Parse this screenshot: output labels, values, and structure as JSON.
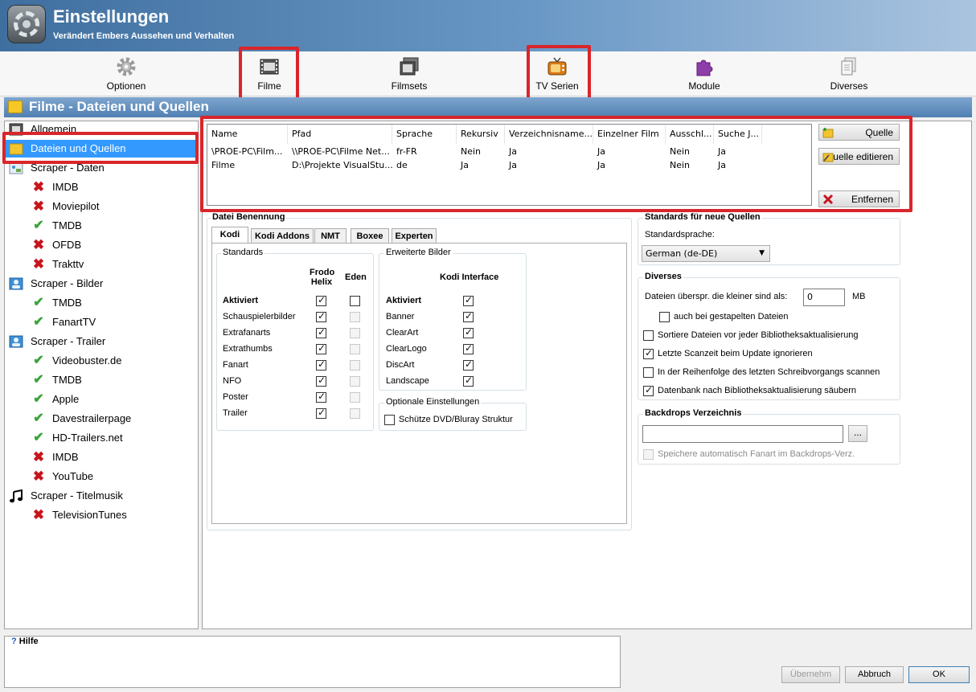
{
  "header": {
    "title": "Einstellungen",
    "subtitle": "Verändert Embers Aussehen und Verhalten"
  },
  "toolbar": {
    "items": [
      {
        "label": "Optionen",
        "icon": "gear-icon"
      },
      {
        "label": "Filme",
        "icon": "film-icon"
      },
      {
        "label": "Filmsets",
        "icon": "filmsets-icon"
      },
      {
        "label": "TV Serien",
        "icon": "tv-icon"
      },
      {
        "label": "Module",
        "icon": "puzzle-icon"
      },
      {
        "label": "Diverses",
        "icon": "documents-icon"
      }
    ]
  },
  "section": {
    "title": "Filme - Dateien und Quellen"
  },
  "tree": {
    "items": [
      {
        "label": "Allgemein",
        "icon": "film-icon"
      },
      {
        "label": "Dateien und Quellen",
        "icon": "folder-icon",
        "selected": true
      },
      {
        "label": "Scraper - Daten",
        "icon": "scraper-icon"
      },
      {
        "label": "IMDB",
        "status": "disabled"
      },
      {
        "label": "Moviepilot",
        "status": "disabled"
      },
      {
        "label": "TMDB",
        "status": "enabled"
      },
      {
        "label": "OFDB",
        "status": "disabled"
      },
      {
        "label": "Trakttv",
        "status": "disabled"
      },
      {
        "label": "Scraper - Bilder",
        "icon": "image-icon"
      },
      {
        "label": "TMDB",
        "status": "enabled"
      },
      {
        "label": "FanartTV",
        "status": "enabled"
      },
      {
        "label": "Scraper - Trailer",
        "icon": "image-icon"
      },
      {
        "label": "Videobuster.de",
        "status": "enabled"
      },
      {
        "label": "TMDB",
        "status": "enabled"
      },
      {
        "label": "Apple",
        "status": "enabled"
      },
      {
        "label": "Davestrailerpage",
        "status": "enabled"
      },
      {
        "label": "HD-Trailers.net",
        "status": "enabled"
      },
      {
        "label": "IMDB",
        "status": "disabled"
      },
      {
        "label": "YouTube",
        "status": "disabled"
      },
      {
        "label": "Scraper - Titelmusik",
        "icon": "music-icon"
      },
      {
        "label": "TelevisionTunes",
        "status": "disabled"
      }
    ]
  },
  "sources": {
    "columns": [
      "Name",
      "Pfad",
      "Sprache",
      "Rekursiv",
      "Verzeichnisname...",
      "Einzelner Film",
      "Ausschl...",
      "Suche J..."
    ],
    "rows": [
      [
        "\\PROE-PC\\Film...",
        "\\\\PROE-PC\\Filme Net...",
        "fr-FR",
        "Nein",
        "Ja",
        "Ja",
        "Nein",
        "Ja"
      ],
      [
        "Filme",
        "D:\\Projekte VisualStu...",
        "de",
        "Ja",
        "Ja",
        "Ja",
        "Nein",
        "Ja"
      ]
    ],
    "btn_add": "Quelle",
    "btn_edit": "Quelle editieren",
    "btn_remove": "Entfernen"
  },
  "naming": {
    "title": "Datei Benennung",
    "tabs": [
      "Kodi",
      "Kodi Addons",
      "NMT",
      "Boxee",
      "Experten"
    ],
    "standards": {
      "title": "Standards",
      "col1": "Frodo\nHelix",
      "col2": "Eden",
      "rows": [
        {
          "label": "Aktiviert",
          "bold": true,
          "frodo": true,
          "eden": false,
          "eden_enabled": true
        },
        {
          "label": "Schauspielerbilder",
          "frodo": true,
          "eden": false
        },
        {
          "label": "Extrafanarts",
          "frodo": true,
          "eden": false
        },
        {
          "label": "Extrathumbs",
          "frodo": true,
          "eden": false
        },
        {
          "label": "Fanart",
          "frodo": true,
          "eden": false
        },
        {
          "label": "NFO",
          "frodo": true,
          "eden": false
        },
        {
          "label": "Poster",
          "frodo": true,
          "eden": false
        },
        {
          "label": "Trailer",
          "frodo": true,
          "eden": false
        }
      ]
    },
    "extended": {
      "title": "Erweiterte Bilder",
      "col": "Kodi Interface",
      "rows": [
        {
          "label": "Aktiviert",
          "bold": true,
          "checked": true
        },
        {
          "label": "Banner",
          "checked": true
        },
        {
          "label": "ClearArt",
          "checked": true
        },
        {
          "label": "ClearLogo",
          "checked": true
        },
        {
          "label": "DiscArt",
          "checked": true
        },
        {
          "label": "Landscape",
          "checked": true
        }
      ]
    },
    "optional": {
      "title": "Optionale Einstellungen",
      "protect_label": "Schütze DVD/Bluray Struktur",
      "protect_checked": false
    }
  },
  "defaults": {
    "title": "Standards für neue Quellen",
    "lang_label": "Standardsprache:",
    "lang_value": "German (de-DE)"
  },
  "misc": {
    "title": "Diverses",
    "skip_label": "Dateien überspr. die kleiner sind als:",
    "skip_value": "0",
    "skip_unit": "MB",
    "stacked_label": "auch bei gestapelten Dateien",
    "options": [
      {
        "label": "Sortiere Dateien vor jeder Bibliotheksaktualisierung",
        "checked": false
      },
      {
        "label": "Letzte Scanzeit beim Update ignorieren",
        "checked": true
      },
      {
        "label": "In der Reihenfolge des letzten Schreibvorgangs scannen",
        "checked": false
      },
      {
        "label": "Datenbank nach Bibliotheksaktualisierung säubern",
        "checked": true
      }
    ]
  },
  "backdrops": {
    "title": "Backdrops Verzeichnis",
    "path_value": "",
    "browse_label": "...",
    "auto_label": "Speichere automatisch Fanart im Backdrops-Verz."
  },
  "help": {
    "title": "Hilfe"
  },
  "footer": {
    "apply": "Übernehm",
    "cancel": "Abbruch",
    "ok": "OK"
  },
  "colors": {
    "highlight": "#d9252b",
    "selection": "#3399ff",
    "header": "#4f7fb2"
  }
}
